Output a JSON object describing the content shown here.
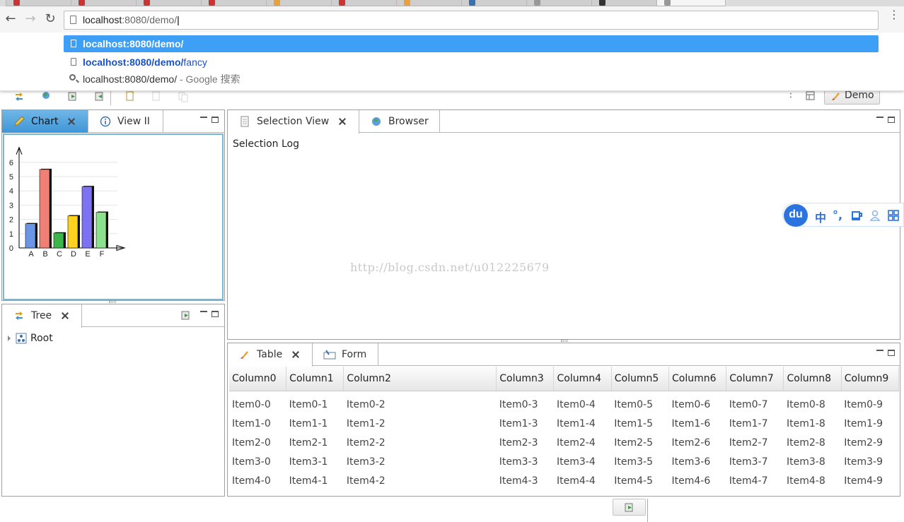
{
  "browser": {
    "url_host": "localhost",
    "url_rest": ":8080/demo/",
    "suggestions": [
      {
        "bold": "localhost:8080/demo/",
        "rest": "",
        "extra": "",
        "type": "page"
      },
      {
        "bold": "localhost:8080/demo/",
        "rest": "fancy",
        "extra": "",
        "type": "page"
      },
      {
        "bold": "",
        "rest": "",
        "plain": "localhost:8080/demo/",
        "extra": " - Google 搜索",
        "type": "search"
      }
    ]
  },
  "toolbar": {
    "demo_label": "Demo"
  },
  "chart_panel": {
    "tabs": [
      {
        "label": "Chart"
      },
      {
        "label": "View II"
      }
    ]
  },
  "tree_panel": {
    "tab_label": "Tree",
    "root_label": "Root"
  },
  "selection_panel": {
    "tabs": [
      {
        "label": "Selection View"
      },
      {
        "label": "Browser"
      }
    ],
    "log_title": "Selection Log"
  },
  "table_panel": {
    "tabs": [
      {
        "label": "Table"
      },
      {
        "label": "Form"
      }
    ],
    "columns": [
      "Column0",
      "Column1",
      "Column2",
      "Column3",
      "Column4",
      "Column5",
      "Column6",
      "Column7",
      "Column8",
      "Column9"
    ],
    "rows": [
      [
        "Item0-0",
        "Item0-1",
        "Item0-2",
        "Item0-3",
        "Item0-4",
        "Item0-5",
        "Item0-6",
        "Item0-7",
        "Item0-8",
        "Item0-9"
      ],
      [
        "Item1-0",
        "Item1-1",
        "Item1-2",
        "Item1-3",
        "Item1-4",
        "Item1-5",
        "Item1-6",
        "Item1-7",
        "Item1-8",
        "Item1-9"
      ],
      [
        "Item2-0",
        "Item2-1",
        "Item2-2",
        "Item2-3",
        "Item2-4",
        "Item2-5",
        "Item2-6",
        "Item2-7",
        "Item2-8",
        "Item2-9"
      ],
      [
        "Item3-0",
        "Item3-1",
        "Item3-2",
        "Item3-3",
        "Item3-4",
        "Item3-5",
        "Item3-6",
        "Item3-7",
        "Item3-8",
        "Item3-9"
      ],
      [
        "Item4-0",
        "Item4-1",
        "Item4-2",
        "Item4-3",
        "Item4-4",
        "Item4-5",
        "Item4-6",
        "Item4-7",
        "Item4-8",
        "Item4-9"
      ]
    ]
  },
  "chart_data": {
    "type": "bar",
    "categories": [
      "A",
      "B",
      "C",
      "D",
      "E",
      "F"
    ],
    "values": [
      1.7,
      5.5,
      1.05,
      2.25,
      4.3,
      2.5
    ],
    "colors": [
      "#6b96e6",
      "#f08076",
      "#3cb54a",
      "#ffd21f",
      "#7d72f2",
      "#8de08c"
    ],
    "y_ticks": [
      0,
      1,
      2,
      3,
      4,
      5,
      6
    ],
    "ylim": [
      0,
      6.6
    ]
  },
  "ime": {
    "logo": "du",
    "lang": "中"
  },
  "watermark": "http://blog.csdn.net/u012225679"
}
